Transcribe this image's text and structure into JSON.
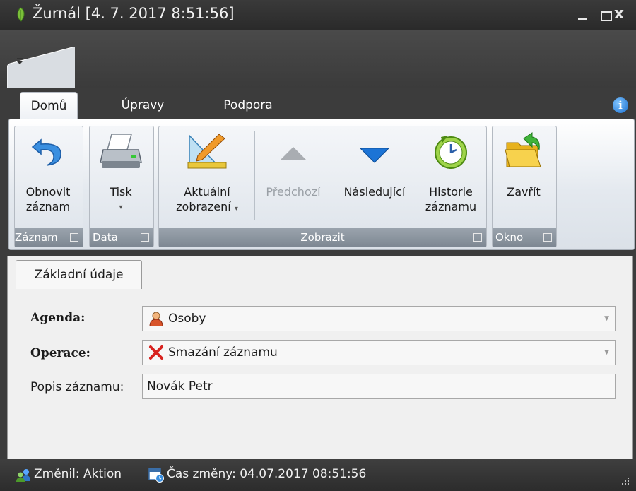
{
  "window": {
    "title": "Žurnál [4. 7. 2017 8:51:56]",
    "close_glyph": "x"
  },
  "quick_access": {
    "customize_glyph": "₹"
  },
  "tabs": [
    {
      "label": "Domů",
      "active": true
    },
    {
      "label": "Úpravy",
      "active": false
    },
    {
      "label": "Podpora",
      "active": false
    }
  ],
  "info_glyph": "i",
  "ribbon": {
    "groups": {
      "zaznam": "Záznam",
      "data": "Data",
      "zobrazit": "Zobrazit",
      "okno": "Okno"
    },
    "buttons": {
      "refresh": [
        "Obnovit",
        "záznam"
      ],
      "print": "Tisk",
      "view": [
        "Aktuální",
        "zobrazení"
      ],
      "previous": "Předchozí",
      "next": "Následující",
      "history": [
        "Historie",
        "záznamu"
      ],
      "close": "Zavřít"
    },
    "dropdown_glyph": "▾"
  },
  "form": {
    "tab": "Základní údaje",
    "agenda_label": "Agenda:",
    "agenda_value": "Osoby",
    "operation_label": "Operace:",
    "operation_value": "Smazání záznamu",
    "description_label": "Popis záznamu:",
    "description_value": "Novák Petr",
    "dropdown_glyph": "▼"
  },
  "status": {
    "changed_by": "Změnil: Aktion",
    "changed_at": "Čas změny: 04.07.2017 08:51:56"
  },
  "icons": {
    "app": "leaf-icon",
    "refresh": "undo-arrow-icon",
    "print": "printer-icon",
    "view": "ruler-pencil-icon",
    "previous": "triangle-up-icon",
    "next": "triangle-down-icon",
    "history": "clock-icon",
    "close": "folder-arrow-icon",
    "agenda": "person-icon",
    "operation": "red-x-icon",
    "user": "users-icon",
    "calendar": "calendar-clock-icon"
  },
  "colors": {
    "accent_blue": "#1c74d6",
    "delete_red": "#d8231f",
    "folder_yellow": "#f2c22c"
  }
}
